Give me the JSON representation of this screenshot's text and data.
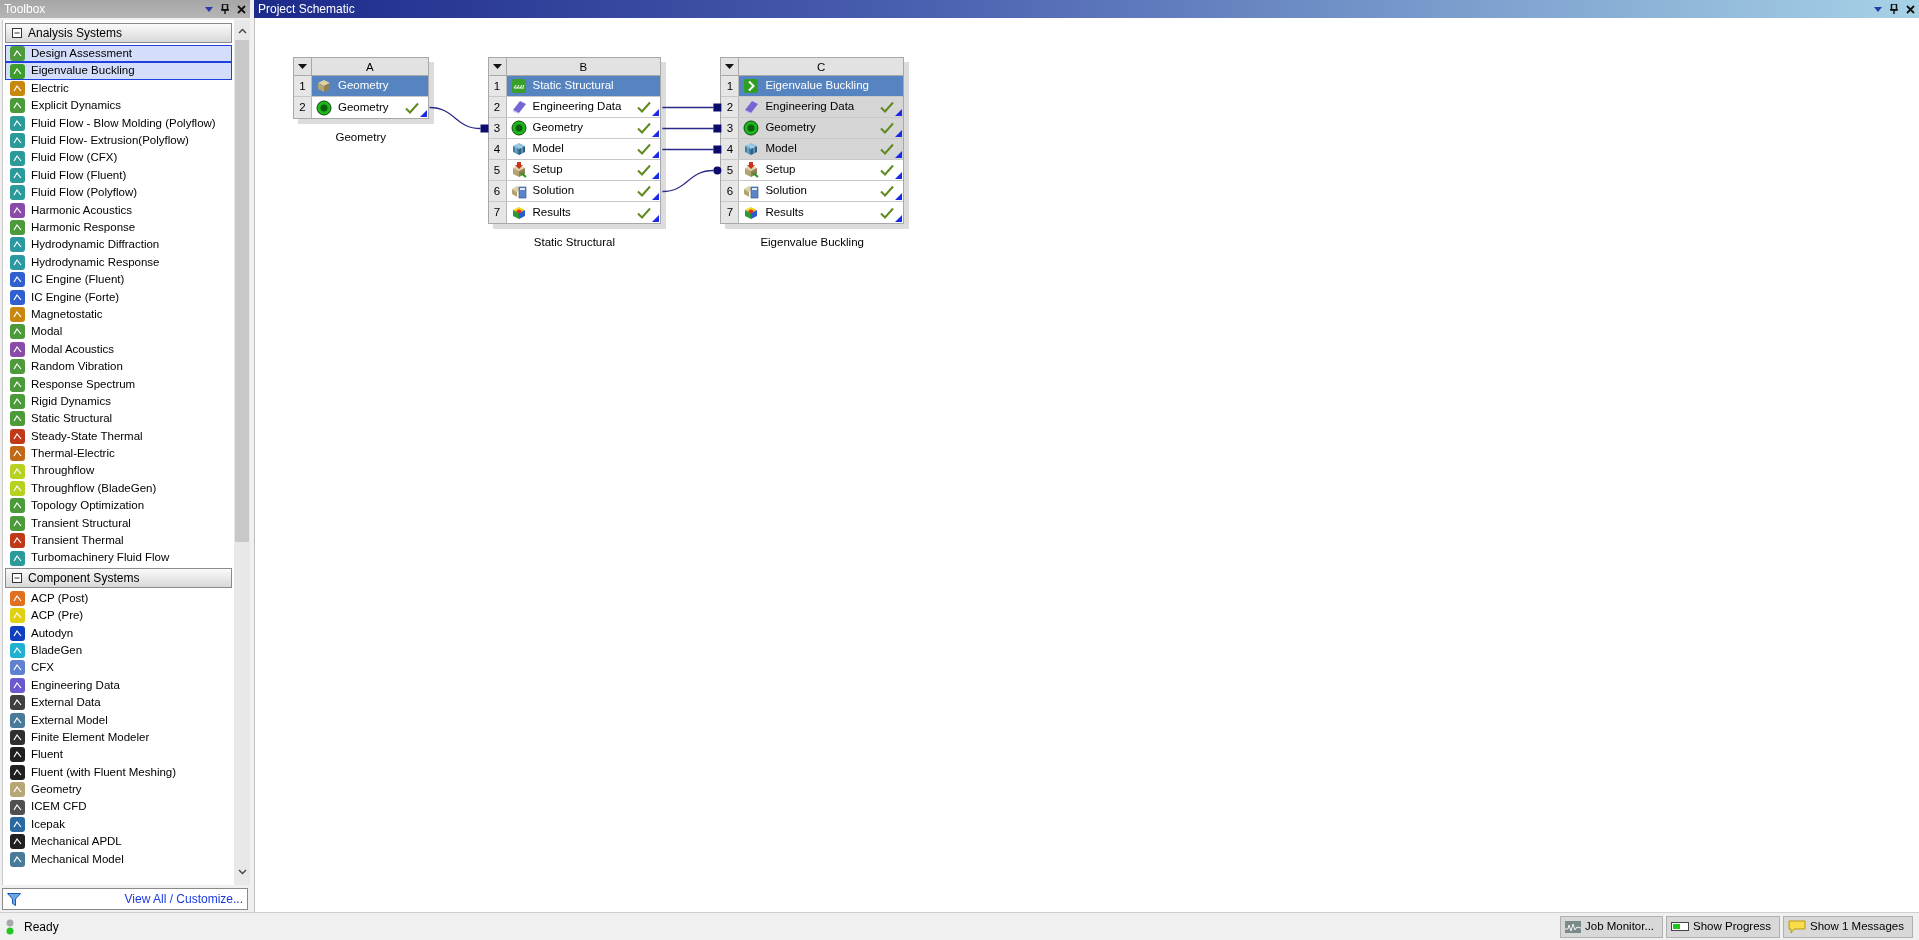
{
  "toolbox": {
    "title": "Toolbox",
    "groups": [
      {
        "title": "Analysis Systems",
        "expanded": true,
        "items": [
          {
            "label": "Design Assessment",
            "selected": true,
            "color": "#4c9a3a"
          },
          {
            "label": "Eigenvalue Buckling",
            "selected": true,
            "color": "#3c9c2c"
          },
          {
            "label": "Electric",
            "selected": false,
            "color": "#c8880e"
          },
          {
            "label": "Explicit Dynamics",
            "selected": false,
            "color": "#4c9a3a"
          },
          {
            "label": "Fluid Flow - Blow Molding (Polyflow)",
            "selected": false,
            "color": "#2a9a9a"
          },
          {
            "label": "Fluid Flow- Extrusion(Polyflow)",
            "selected": false,
            "color": "#2a9a9a"
          },
          {
            "label": "Fluid Flow (CFX)",
            "selected": false,
            "color": "#2a9a9a"
          },
          {
            "label": "Fluid Flow (Fluent)",
            "selected": false,
            "color": "#2a9a9a"
          },
          {
            "label": "Fluid Flow (Polyflow)",
            "selected": false,
            "color": "#2a9a9a"
          },
          {
            "label": "Harmonic Acoustics",
            "selected": false,
            "color": "#8a4aa8"
          },
          {
            "label": "Harmonic Response",
            "selected": false,
            "color": "#4c9a3a"
          },
          {
            "label": "Hydrodynamic Diffraction",
            "selected": false,
            "color": "#2a9aa0"
          },
          {
            "label": "Hydrodynamic Response",
            "selected": false,
            "color": "#2a9aa0"
          },
          {
            "label": "IC Engine (Fluent)",
            "selected": false,
            "color": "#3060d0"
          },
          {
            "label": "IC Engine (Forte)",
            "selected": false,
            "color": "#3060d0"
          },
          {
            "label": "Magnetostatic",
            "selected": false,
            "color": "#c8880e"
          },
          {
            "label": "Modal",
            "selected": false,
            "color": "#4c9a3a"
          },
          {
            "label": "Modal Acoustics",
            "selected": false,
            "color": "#8a4aa8"
          },
          {
            "label": "Random Vibration",
            "selected": false,
            "color": "#4c9a3a"
          },
          {
            "label": "Response Spectrum",
            "selected": false,
            "color": "#4c9a3a"
          },
          {
            "label": "Rigid Dynamics",
            "selected": false,
            "color": "#4c9a3a"
          },
          {
            "label": "Static Structural",
            "selected": false,
            "color": "#4c9a3a"
          },
          {
            "label": "Steady-State Thermal",
            "selected": false,
            "color": "#c03a1a"
          },
          {
            "label": "Thermal-Electric",
            "selected": false,
            "color": "#c06a18"
          },
          {
            "label": "Throughflow",
            "selected": false,
            "color": "#b8d020"
          },
          {
            "label": "Throughflow (BladeGen)",
            "selected": false,
            "color": "#b8d020"
          },
          {
            "label": "Topology Optimization",
            "selected": false,
            "color": "#4c9a3a"
          },
          {
            "label": "Transient Structural",
            "selected": false,
            "color": "#4c9a3a"
          },
          {
            "label": "Transient Thermal",
            "selected": false,
            "color": "#c03a1a"
          },
          {
            "label": "Turbomachinery Fluid Flow",
            "selected": false,
            "color": "#2a9a9a"
          }
        ]
      },
      {
        "title": "Component Systems",
        "expanded": true,
        "items": [
          {
            "label": "ACP (Post)",
            "selected": false,
            "color": "#e07020"
          },
          {
            "label": "ACP (Pre)",
            "selected": false,
            "color": "#e0d010"
          },
          {
            "label": "Autodyn",
            "selected": false,
            "color": "#1040c0"
          },
          {
            "label": "BladeGen",
            "selected": false,
            "color": "#20b0d0"
          },
          {
            "label": "CFX",
            "selected": false,
            "color": "#6080d0"
          },
          {
            "label": "Engineering Data",
            "selected": false,
            "color": "#6a5acd"
          },
          {
            "label": "External Data",
            "selected": false,
            "color": "#404040"
          },
          {
            "label": "External Model",
            "selected": false,
            "color": "#4a7a9a"
          },
          {
            "label": "Finite Element Modeler",
            "selected": false,
            "color": "#303030"
          },
          {
            "label": "Fluent",
            "selected": false,
            "color": "#202020"
          },
          {
            "label": "Fluent (with Fluent Meshing)",
            "selected": false,
            "color": "#202020"
          },
          {
            "label": "Geometry",
            "selected": false,
            "color": "#b8a676"
          },
          {
            "label": "ICEM CFD",
            "selected": false,
            "color": "#505050"
          },
          {
            "label": "Icepak",
            "selected": false,
            "color": "#2a6aa0"
          },
          {
            "label": "Mechanical APDL",
            "selected": false,
            "color": "#202020"
          },
          {
            "label": "Mechanical Model",
            "selected": false,
            "color": "#4a7a9a"
          }
        ]
      }
    ],
    "footer_link": "View All / Customize..."
  },
  "schematic": {
    "title": "Project Schematic",
    "systems": [
      {
        "letter": "A",
        "caption": "Geometry",
        "rows": [
          {
            "number": "1",
            "label": "Geometry",
            "kind": "geometry",
            "up_to_date": false,
            "shared": false,
            "output": false
          },
          {
            "number": "2",
            "label": "Geometry",
            "kind": "dm",
            "up_to_date": true,
            "shared": false,
            "output": true
          }
        ]
      },
      {
        "letter": "B",
        "caption": "Static Structural",
        "rows": [
          {
            "number": "1",
            "label": "Static Structural",
            "kind": "static",
            "up_to_date": false,
            "shared": false,
            "output": false
          },
          {
            "number": "2",
            "label": "Engineering Data",
            "kind": "engdata",
            "up_to_date": true,
            "shared": false,
            "output": true
          },
          {
            "number": "3",
            "label": "Geometry",
            "kind": "dm",
            "up_to_date": true,
            "shared": false,
            "output": true,
            "input": {
              "kind": "share"
            }
          },
          {
            "number": "4",
            "label": "Model",
            "kind": "model",
            "up_to_date": true,
            "shared": false,
            "output": true
          },
          {
            "number": "5",
            "label": "Setup",
            "kind": "setup",
            "up_to_date": true,
            "shared": false,
            "output": false
          },
          {
            "number": "6",
            "label": "Solution",
            "kind": "solution",
            "up_to_date": true,
            "shared": false,
            "output": true
          },
          {
            "number": "7",
            "label": "Results",
            "kind": "results",
            "up_to_date": true,
            "shared": false,
            "output": false
          }
        ]
      },
      {
        "letter": "C",
        "caption": "Eigenvalue Buckling",
        "rows": [
          {
            "number": "1",
            "label": "Eigenvalue Buckling",
            "kind": "buckling",
            "up_to_date": false,
            "shared": false,
            "output": false
          },
          {
            "number": "2",
            "label": "Engineering Data",
            "kind": "engdata",
            "up_to_date": true,
            "shared": true,
            "output": false,
            "input": {
              "kind": "share"
            }
          },
          {
            "number": "3",
            "label": "Geometry",
            "kind": "dm",
            "up_to_date": true,
            "shared": true,
            "output": false,
            "input": {
              "kind": "share"
            }
          },
          {
            "number": "4",
            "label": "Model",
            "kind": "model",
            "up_to_date": true,
            "shared": true,
            "output": false,
            "input": {
              "kind": "share"
            }
          },
          {
            "number": "5",
            "label": "Setup",
            "kind": "setup",
            "up_to_date": true,
            "shared": false,
            "output": false,
            "input": {
              "kind": "transfer"
            }
          },
          {
            "number": "6",
            "label": "Solution",
            "kind": "solution",
            "up_to_date": true,
            "shared": false,
            "output": false
          },
          {
            "number": "7",
            "label": "Results",
            "kind": "results",
            "up_to_date": true,
            "shared": false,
            "output": false
          }
        ]
      }
    ]
  },
  "status_bar": {
    "text": "Ready",
    "buttons": [
      {
        "label": "Job Monitor...",
        "kind": "monitor"
      },
      {
        "label": "Show Progress",
        "kind": "progress"
      },
      {
        "label": "Show 1 Messages",
        "kind": "messages"
      }
    ]
  }
}
